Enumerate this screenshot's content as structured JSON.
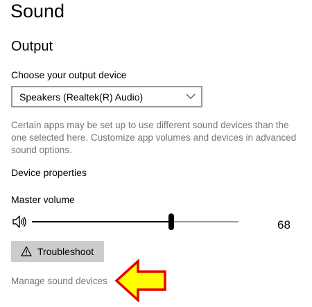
{
  "page": {
    "title": "Sound"
  },
  "output": {
    "section_title": "Output",
    "device_label": "Choose your output device",
    "device_selected": "Speakers (Realtek(R) Audio)",
    "description": "Certain apps may be set up to use different sound devices than the one selected here. Customize app volumes and devices in advanced sound options.",
    "device_properties_link": "Device properties",
    "master_volume_label": "Master volume",
    "volume": 68,
    "volume_display": "68",
    "troubleshoot_label": "Troubleshoot",
    "manage_link": "Manage sound devices"
  },
  "icons": {
    "dropdown": "chevron-down-icon",
    "speaker": "speaker-icon",
    "warning": "warning-icon",
    "annotation": "left-arrow-icon"
  },
  "colors": {
    "text": "#000000",
    "muted_text": "#767676",
    "dropdown_border": "#999999",
    "slider_fill": "#000000",
    "slider_rest": "#999999",
    "button_bg": "#cccccc",
    "arrow_fill": "#ffff00",
    "arrow_stroke": "#e60000"
  }
}
